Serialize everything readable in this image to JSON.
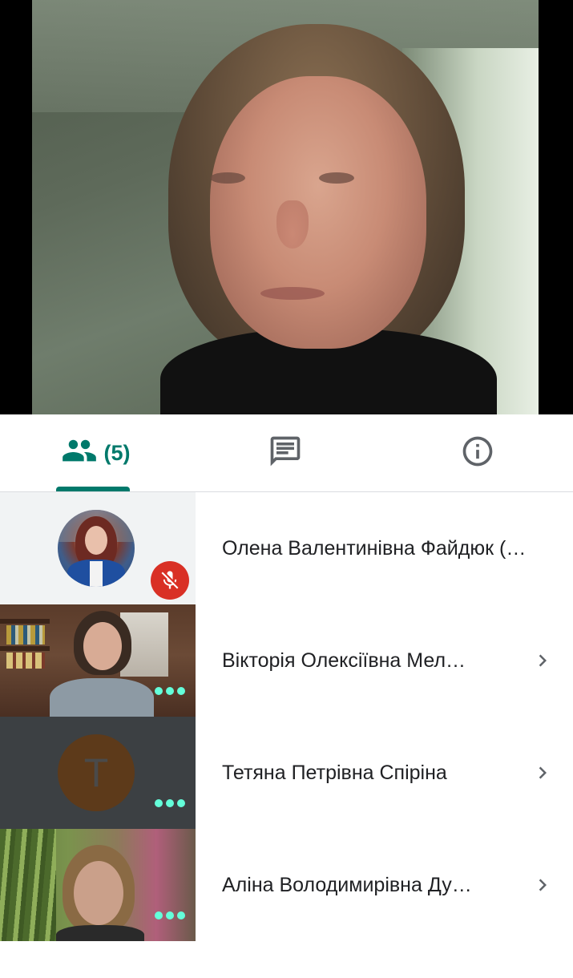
{
  "tabs": {
    "people": {
      "icon": "people-icon",
      "count_label": "(5)",
      "selected": true
    },
    "chat": {
      "icon": "chat-icon"
    },
    "info": {
      "icon": "info-icon"
    }
  },
  "participants": [
    {
      "name": "Олена Валентинівна Файдюк (…",
      "muted": true,
      "tile": "photo-avatar",
      "has_chevron": false
    },
    {
      "name": "Вікторія Олексіївна Мел…",
      "muted": false,
      "tile": "camera",
      "has_chevron": true
    },
    {
      "name": "Тетяна Петрівна Спіріна",
      "muted": false,
      "tile": "letter-avatar",
      "avatar_letter": "T",
      "has_chevron": true
    },
    {
      "name": "Аліна Володимирівна Ду…",
      "muted": false,
      "tile": "camera",
      "has_chevron": true
    }
  ],
  "colors": {
    "accent": "#00796b",
    "mute_badge": "#d93025",
    "activity_dots": "#64ffda",
    "letter_avatar_bg": "#5d3a1a"
  }
}
